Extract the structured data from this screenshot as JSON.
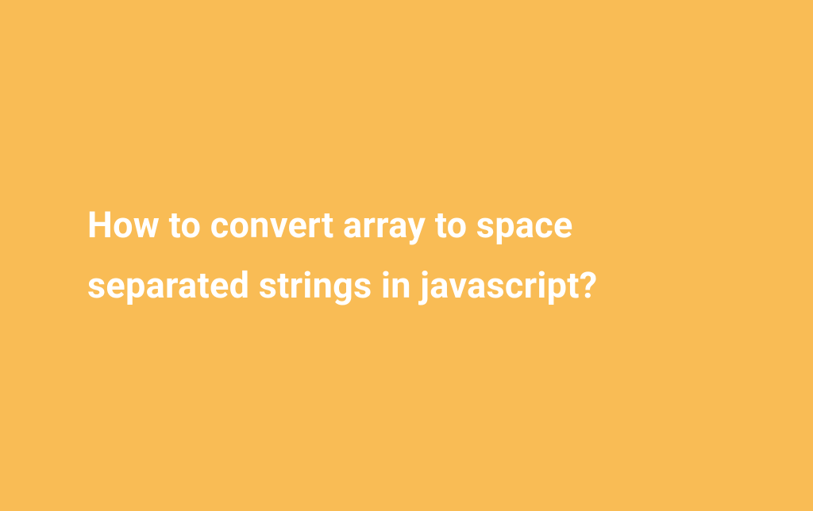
{
  "heading": "How to convert array to space separated strings in javascript?",
  "colors": {
    "background": "#f9bc55",
    "text": "#ffffff"
  }
}
